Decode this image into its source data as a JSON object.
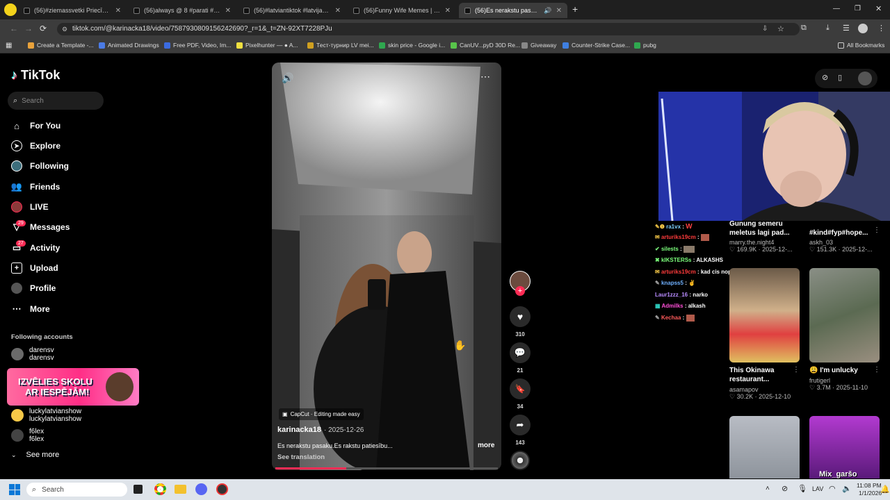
{
  "browser": {
    "tabs": [
      {
        "label": "(56)#ziemassvetki Priecīgus Krie"
      },
      {
        "label": "(56)always @ 8 #parati #fyp #v"
      },
      {
        "label": "(56)#latviantiktok #latvijastikto"
      },
      {
        "label": "(56)Funny Wife Memes | TikTok"
      },
      {
        "label": "(56)Es nerakstu pasaku. Es r"
      }
    ],
    "new_tab": "+",
    "url": "tiktok.com/@karinacka18/video/7587930809156242690?_r=1&_t=ZN-92XT7228PJu",
    "bookmarks": [
      {
        "label": "Create a Template -...",
        "color": "#e9a23b"
      },
      {
        "label": "Animated Drawings",
        "color": "#4b7be5"
      },
      {
        "label": "Free PDF, Video, Im...",
        "color": "#3b6be0"
      },
      {
        "label": "Pixelhunter — ● A...",
        "color": "#f0e040"
      },
      {
        "label": "Тест-турнир LV mei...",
        "color": "#d0a020"
      },
      {
        "label": "skin price - Google i...",
        "color": "#2fa84f"
      },
      {
        "label": "CanUV...pyD 30D Re...",
        "color": "#58c44a"
      },
      {
        "label": "Giveaway",
        "color": "#888888"
      },
      {
        "label": "Counter-Strike Case...",
        "color": "#3f7fe0"
      },
      {
        "label": "pubg",
        "color": "#2fa84f"
      }
    ],
    "all_bookmarks": "All Bookmarks"
  },
  "sidebar": {
    "logo": "TikTok",
    "search_placeholder": "Search",
    "nav": [
      {
        "label": "For You",
        "icon": "home-icon"
      },
      {
        "label": "Explore",
        "icon": "compass-icon"
      },
      {
        "label": "Following",
        "icon": "following-avatar-icon"
      },
      {
        "label": "Friends",
        "icon": "friends-icon"
      },
      {
        "label": "LIVE",
        "icon": "live-icon"
      },
      {
        "label": "Messages",
        "icon": "messages-icon",
        "badge": "29"
      },
      {
        "label": "Activity",
        "icon": "activity-icon",
        "badge": "27"
      },
      {
        "label": "Upload",
        "icon": "upload-icon"
      },
      {
        "label": "Profile",
        "icon": "profile-icon"
      },
      {
        "label": "More",
        "icon": "more-icon"
      }
    ],
    "following_title": "Following accounts",
    "accounts": [
      {
        "name": "darensv",
        "handle": "darensv"
      },
      {
        "name": "luckylatvianshow",
        "handle": "luckylatvianshow"
      },
      {
        "name": "f6lex",
        "handle": "f6lex"
      }
    ],
    "promo_line1": "IZVĒLIES SKOLU",
    "promo_line2": "AR IESPĒJĀM!",
    "see_more": "See more"
  },
  "video": {
    "watermark": "CapCut · Editing made easy",
    "author": "karinacka18",
    "date": "· 2025-12-26",
    "caption": "Es nerakstu pasaku.Es rakstu patiesību...",
    "more": "more",
    "see_translation": "See translation",
    "progress": 0.32
  },
  "actions": {
    "likes": "310",
    "comments": "21",
    "saves": "34",
    "shares": "143"
  },
  "chat": [
    {
      "user": "ra1vx",
      "msg": "W",
      "ucolor": "#7fd3ff",
      "mcolor": "#ff4040"
    },
    {
      "user": "arturiks19cm",
      "msg": "",
      "ucolor": "#ff3b3b",
      "mcolor": "#fff"
    },
    {
      "user": "silests",
      "msg": "",
      "ucolor": "#7cff7c",
      "mcolor": "#fff"
    },
    {
      "user": "kIKSTERSs",
      "msg": "ALKASHS",
      "ucolor": "#7cff7c",
      "mcolor": "#fff"
    },
    {
      "user": "arturiks19cm",
      "msg": "kad cis nopirksi tad kratisies",
      "ucolor": "#ff3b3b",
      "mcolor": "#fff"
    },
    {
      "user": "knapss5",
      "msg": "",
      "ucolor": "#6fb0ff",
      "mcolor": "#fff"
    },
    {
      "user": "Laur1zzz_16",
      "msg": "narko",
      "ucolor": "#b98cff",
      "mcolor": "#fff"
    },
    {
      "user": "Admilks",
      "msg": "alkash",
      "ucolor": "#ff4fd8",
      "mcolor": "#fff"
    },
    {
      "user": "Kechaa",
      "msg": "",
      "ucolor": "#ff5b5b",
      "mcolor": "#fff"
    }
  ],
  "grid": [
    {
      "title": "Gunung semeru meletus lagi pad...",
      "author": "marry.the.night4",
      "likes": "169.9K",
      "date": "2025-12-..."
    },
    {
      "title": "#kind#fyp#hope...",
      "author": "askh_03",
      "likes": "151.3K",
      "date": "2025-12-..."
    },
    {
      "title": "This Okinawa restaurant...",
      "author": "asamapov",
      "likes": "30.2K",
      "date": "2025-12-10"
    },
    {
      "title": "😩 I'm unlucky",
      "author": "frutigerl",
      "likes": "3.7M",
      "date": "2025-11-10"
    },
    {
      "overlay": "Mix_garšo"
    }
  ],
  "taskbar": {
    "search": "Search",
    "lang": "LAV",
    "time": "11:08 PM",
    "date": "1/1/2026"
  }
}
